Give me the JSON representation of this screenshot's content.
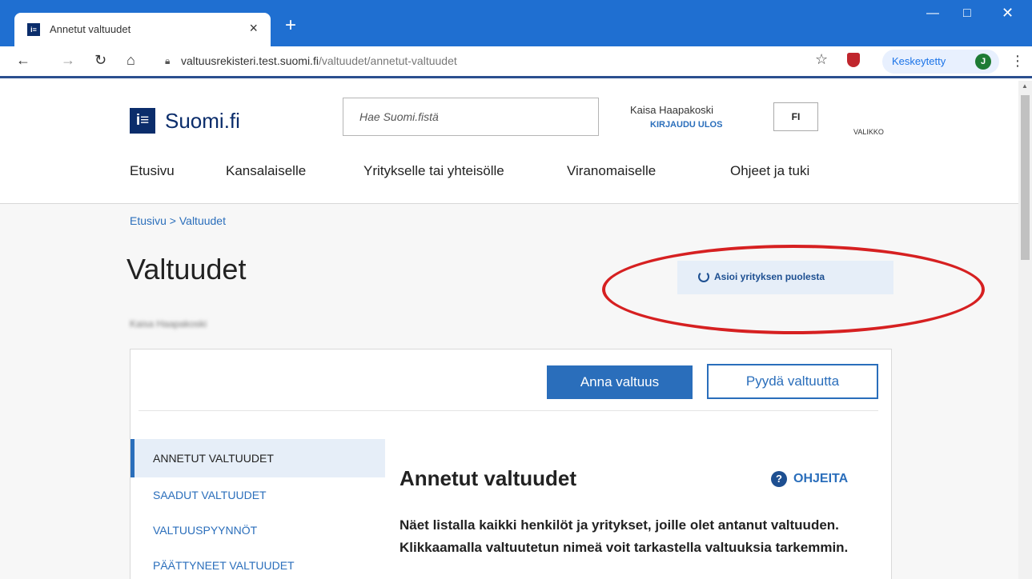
{
  "browser": {
    "tab_title": "Annetut valtuudet",
    "tab_close": "×",
    "new_tab": "+",
    "url_host": "valtuusrekisteri.test.suomi.fi",
    "url_path": "/valtuudet/annetut-valtuudet",
    "profile_status": "Keskeytetty",
    "profile_initial": "J",
    "favicon_glyph": "i≡"
  },
  "header": {
    "logo_glyph": "i≡",
    "logo_text": "Suomi.fi",
    "search_placeholder": "Hae Suomi.fistä",
    "user_name": "Kaisa Haapakoski",
    "logout_label": "KIRJAUDU ULOS",
    "language": "FI",
    "menu_label": "VALIKKO"
  },
  "nav": {
    "items": [
      "Etusivu",
      "Kansalaiselle",
      "Yritykselle tai yhteisölle",
      "Viranomaiselle",
      "Ohjeet ja tuki"
    ]
  },
  "page": {
    "breadcrumb": "Etusivu > Valtuudet",
    "title": "Valtuudet",
    "subtitle": "Kaisa Haapakoski",
    "act_on_behalf_label": "Asioi yrityksen puolesta"
  },
  "panel": {
    "give_mandate": "Anna valtuus",
    "request_mandate": "Pyydä valtuutta",
    "sidebar": [
      "ANNETUT VALTUUDET",
      "SAADUT VALTUUDET",
      "VALTUUSPYYNNÖT",
      "PÄÄTTYNEET VALTUUDET"
    ],
    "content_title": "Annetut valtuudet",
    "help_label": "OHJEITA",
    "help_glyph": "?",
    "content_body": "Näet listalla kaikki henkilöt ja yritykset, joille olet antanut valtuuden. Klikkaamalla valtuutetun nimeä voit tarkastella valtuuksia tarkemmin."
  },
  "colors": {
    "chrome_blue": "#1f6fd1",
    "brand_navy": "#0b2d6b",
    "link_blue": "#2a6ebb",
    "highlight_red": "#d62021"
  },
  "icons": [
    "tab-favicon",
    "close-icon",
    "plus-icon",
    "minimize-icon",
    "maximize-icon",
    "window-close-icon",
    "back-arrow-icon",
    "forward-arrow-icon",
    "reload-icon",
    "home-icon",
    "lock-icon",
    "star-icon",
    "shield-extension-icon",
    "kebab-menu-icon",
    "refresh-icon",
    "help-icon"
  ]
}
